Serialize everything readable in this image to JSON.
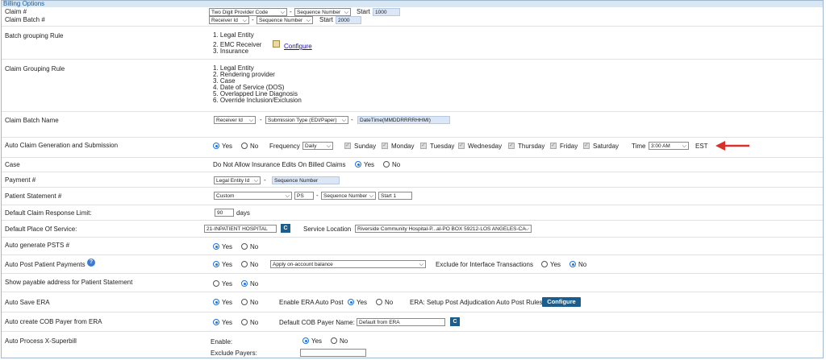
{
  "header": {
    "title": "Billing Options"
  },
  "claim_num": {
    "label": "Claim #",
    "format": "Two Digit Provider Code",
    "dash": "-",
    "seq": "Sequence Number",
    "start_label": "Start",
    "start": "1000"
  },
  "claim_batch_num": {
    "label": "Claim Batch #",
    "format": "Receiver Id",
    "dash": "-",
    "seq": "Sequence Number",
    "start_label": "Start",
    "start": "2000"
  },
  "batch_grouping": {
    "label": "Batch grouping Rule",
    "items": [
      "1. Legal Entity",
      "2. EMC Receiver",
      "3. Insurance"
    ],
    "configure": "Configure"
  },
  "claim_grouping": {
    "label": "Claim Grouping Rule",
    "items": [
      "1. Legal Entity",
      "2. Rendering provider",
      "3. Case",
      "4. Date of Service (DOS)",
      "5. Overlapped Line Diagnosis",
      "6. Override Inclusion/Exclusion"
    ]
  },
  "claim_batch_name": {
    "label": "Claim Batch Name",
    "part1": "Receiver Id",
    "part2": "Submission Type (EDI/Paper)",
    "part3": "DateTime(MMDDRRRRHHMI)",
    "dash": "-"
  },
  "auto_claim": {
    "label": "Auto Claim Generation and Submission",
    "yes": "Yes",
    "no": "No",
    "frequency_label": "Frequency",
    "frequency": "Daily",
    "days": [
      "Sunday",
      "Monday",
      "Tuesday",
      "Wednesday",
      "Thursday",
      "Friday",
      "Saturday"
    ],
    "time_label": "Time",
    "time": "3:00 AM",
    "tz": "EST",
    "arrow_color": "#d9302a"
  },
  "case": {
    "label": "Case",
    "text": "Do Not Allow Insurance Edits On Billed Claims",
    "yes": "Yes",
    "no": "No"
  },
  "payment_num": {
    "label": "Payment #",
    "format": "Legal Entity Id",
    "dash": "-",
    "seq": "Sequence Number"
  },
  "patient_stmt": {
    "label": "Patient Statement #",
    "format": "Custom",
    "prefix": "PS",
    "dash": "-",
    "seq": "Sequence Number",
    "start_label": "Start 1"
  },
  "claim_response": {
    "label": "Default Claim Response Limit:",
    "value": "90",
    "unit": "days"
  },
  "place_of_service": {
    "label": "Default Place Of Service:",
    "value": "21-INPATIENT HOSPITAL",
    "c": "C",
    "location_label": "Service Location",
    "location": "Riverside Community Hospital-P...al-PO BOX 59212-LOS ANGELES-CA"
  },
  "psts": {
    "label": "Auto generate PSTS #",
    "yes": "Yes",
    "no": "No"
  },
  "auto_post": {
    "label": "Auto Post Patient Payments",
    "help": "?",
    "yes": "Yes",
    "no": "No",
    "option": "Apply on-account balance",
    "exclude_label": "Exclude for Interface Transactions",
    "ex_yes": "Yes",
    "ex_no": "No"
  },
  "payable_addr": {
    "label": "Show payable address for Patient Statement",
    "yes": "Yes",
    "no": "No"
  },
  "auto_save_era": {
    "label": "Auto Save ERA",
    "yes": "Yes",
    "no": "No",
    "enable_label": "Enable ERA Auto Post",
    "en_yes": "Yes",
    "en_no": "No",
    "setup_label": "ERA: Setup Post Adjudication Auto Post Rules",
    "configure": "Configure"
  },
  "cob_payer": {
    "label": "Auto create COB Payer from ERA",
    "yes": "Yes",
    "no": "No",
    "name_label": "Default COB Payer Name:",
    "name": "Default from ERA",
    "c": "C"
  },
  "x_superbill": {
    "label": "Auto Process X-Superbill",
    "enable_label": "Enable:",
    "yes": "Yes",
    "no": "No",
    "exclude_label": "Exclude Payers:",
    "exclude": ""
  }
}
